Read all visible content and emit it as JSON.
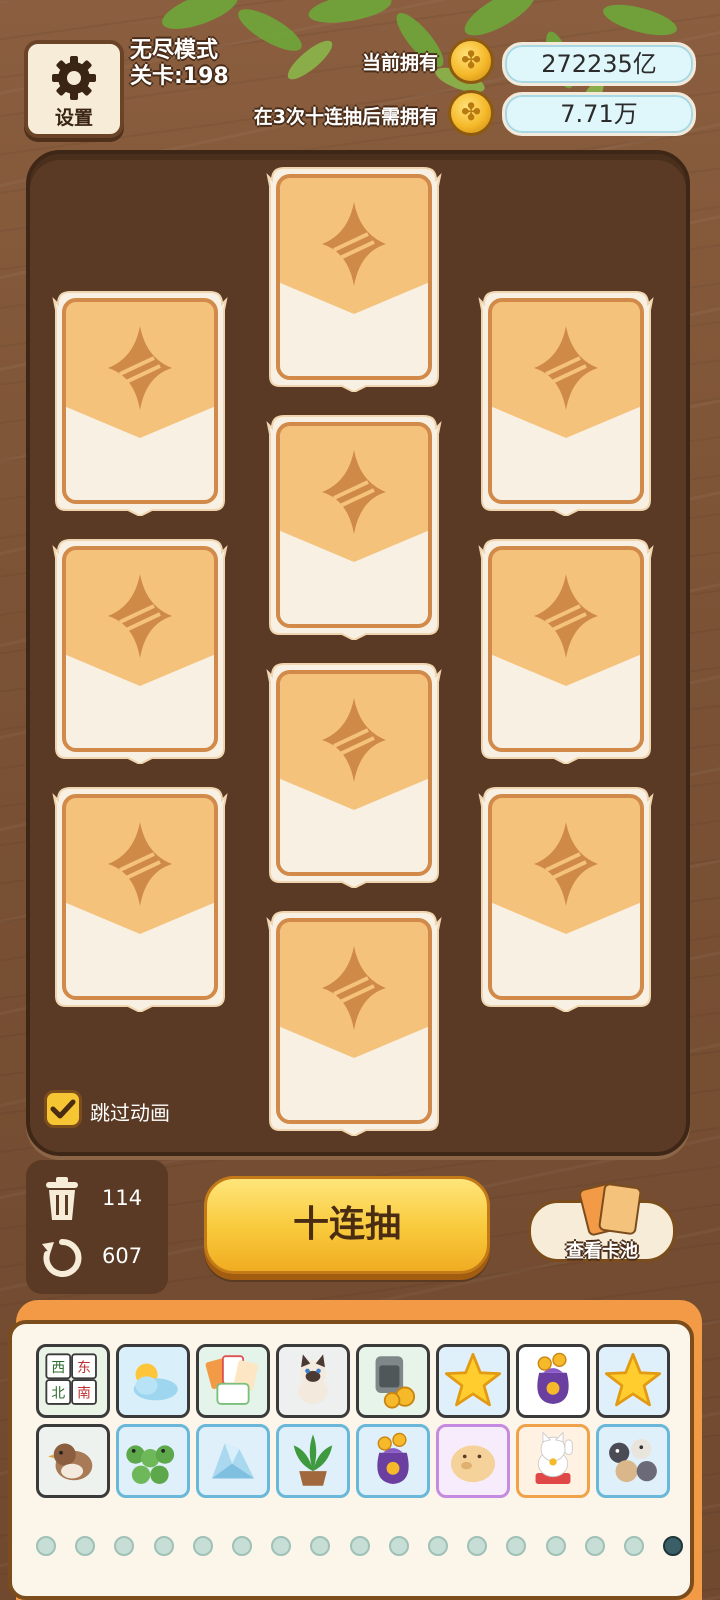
{
  "header": {
    "settings_label": "设置",
    "mode": "无尽模式",
    "level": "关卡:198",
    "owned_label": "当前拥有",
    "owned_value": "272235亿",
    "required_label": "在3次十连抽后需拥有",
    "required_value": "7.71万"
  },
  "board": {
    "card_count": 10,
    "skip_animation_label": "跳过动画",
    "skip_animation_checked": true
  },
  "controls": {
    "discard_count": "114",
    "refresh_count": "607",
    "draw_button_label": "十连抽",
    "view_pool_label": "查看卡池"
  },
  "collection": {
    "items": [
      {
        "icon": "mahjong-tiles-icon",
        "border": "#3a3a3a",
        "bg": "#e9f3e6",
        "glyphs": [
          "西",
          "东",
          "北",
          "南"
        ]
      },
      {
        "icon": "sun-cloud-icon",
        "border": "#3a3a3a",
        "bg": "#d9f0fb"
      },
      {
        "icon": "card-pack-icon",
        "border": "#3a3a3a",
        "bg": "#e4f4ea"
      },
      {
        "icon": "siamese-cat-icon",
        "border": "#3a3a3a",
        "bg": "#eef0f0"
      },
      {
        "icon": "coin-jar-icon",
        "border": "#3a3a3a",
        "bg": "#e7f4ea"
      },
      {
        "icon": "gold-star-icon",
        "border": "#3a3a3a",
        "bg": "#dff0fb"
      },
      {
        "icon": "lucky-bag-icon",
        "border": "#3a3a3a",
        "bg": "#ffffff"
      },
      {
        "icon": "gold-star-icon",
        "border": "#3a3a3a",
        "bg": "#dff0fb"
      },
      {
        "icon": "sparrow-icon",
        "border": "#3a3a3a",
        "bg": "#edf2ee"
      },
      {
        "icon": "caterpillar-icon",
        "border": "#6ab7d9",
        "bg": "#dff0fb"
      },
      {
        "icon": "ice-crystal-icon",
        "border": "#6ab7d9",
        "bg": "#dff0fb"
      },
      {
        "icon": "potted-plant-icon",
        "border": "#6ab7d9",
        "bg": "#dff0fb"
      },
      {
        "icon": "lucky-bag-icon",
        "border": "#6ab7d9",
        "bg": "#dff0fb"
      },
      {
        "icon": "piggy-icon",
        "border": "#c58be0",
        "bg": "#f6ecfb"
      },
      {
        "icon": "lucky-cat-icon",
        "border": "#f0a24a",
        "bg": "#fff2e2"
      },
      {
        "icon": "cat-gang-icon",
        "border": "#6ab7d9",
        "bg": "#dff0fb"
      }
    ],
    "page_count": 17,
    "active_page": 17
  },
  "colors": {
    "card_top": "#f5c27c",
    "card_bottom": "#f8f1e3",
    "card_frame": "#d18a4a",
    "button_yellow": "#f8c93a"
  }
}
